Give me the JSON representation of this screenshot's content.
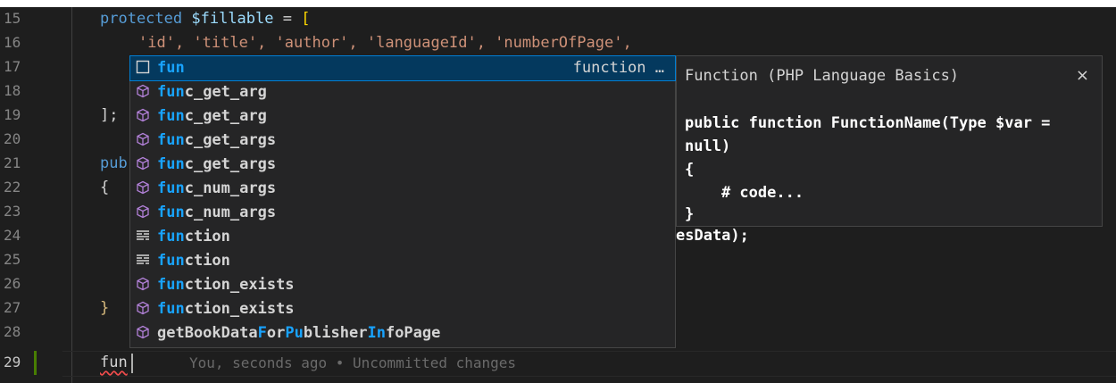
{
  "colors": {
    "editor_bg": "#1e1e1e",
    "widget_bg": "#252526",
    "selection_bg": "#04395e",
    "match_highlight": "#18a3ff",
    "keyword": "#569cd6",
    "string": "#ce9178",
    "variable": "#9cdcfe",
    "line_number": "#858585",
    "git_modified": "#487e02",
    "error_squiggle": "#f14c4c"
  },
  "editor": {
    "line_numbers": [
      "15",
      "16",
      "17",
      "18",
      "19",
      "20",
      "21",
      "22",
      "23",
      "24",
      "25",
      "26",
      "27",
      "28",
      "29"
    ],
    "active_line": "29",
    "line15": {
      "kw": "protected",
      "var": "$fillable",
      "rest": " = ",
      "brk": "["
    },
    "line16": {
      "text": "'id', 'title', 'author', 'languageId', 'numberOfPage',"
    },
    "line19": {
      "text": "];"
    },
    "line21": {
      "text": "pub"
    },
    "line22": {
      "text": "{"
    },
    "line24_tail": {
      "text": "esData);"
    },
    "line27": {
      "text": "}"
    },
    "typed_text": "fun",
    "blame": "You, seconds ago • Uncommitted changes"
  },
  "suggest": {
    "items": [
      {
        "icon": "snippet-box-icon",
        "prefix": "fun",
        "rest": "",
        "detail": "function …",
        "selected": true
      },
      {
        "icon": "cube-icon",
        "prefix": "fun",
        "rest": "c_get_arg",
        "detail": ""
      },
      {
        "icon": "cube-icon",
        "prefix": "fun",
        "rest": "c_get_arg",
        "detail": ""
      },
      {
        "icon": "cube-icon",
        "prefix": "fun",
        "rest": "c_get_args",
        "detail": ""
      },
      {
        "icon": "cube-icon",
        "prefix": "fun",
        "rest": "c_get_args",
        "detail": ""
      },
      {
        "icon": "cube-icon",
        "prefix": "fun",
        "rest": "c_num_args",
        "detail": ""
      },
      {
        "icon": "cube-icon",
        "prefix": "fun",
        "rest": "c_num_args",
        "detail": ""
      },
      {
        "icon": "keyword-lines-icon",
        "prefix": "fun",
        "rest": "ction",
        "detail": ""
      },
      {
        "icon": "keyword-lines-icon",
        "prefix": "fun",
        "rest": "ction",
        "detail": ""
      },
      {
        "icon": "cube-icon",
        "prefix": "fun",
        "rest": "ction_exists",
        "detail": ""
      },
      {
        "icon": "cube-icon",
        "prefix": "fun",
        "rest": "ction_exists",
        "detail": ""
      },
      {
        "icon": "cube-icon",
        "prefix": "",
        "rest": "getBookDataForPublisherInfoPage",
        "detail": ""
      }
    ]
  },
  "docs": {
    "title": "Function (PHP Language Basics)",
    "close": "×",
    "lines": [
      "public function FunctionName(Type $var =",
      "null)",
      "{",
      "    # code...",
      "}"
    ]
  }
}
